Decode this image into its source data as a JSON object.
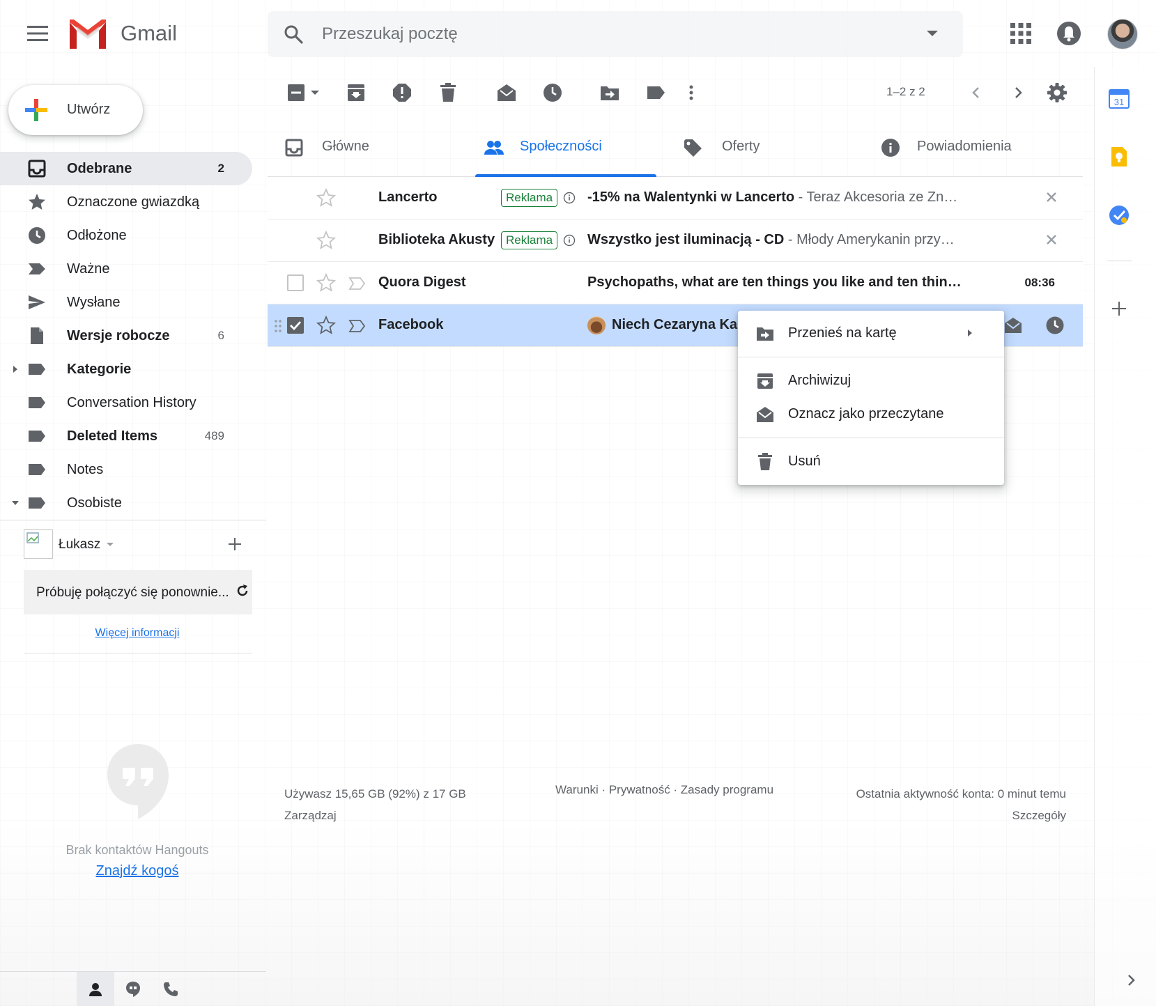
{
  "header": {
    "app_name": "Gmail",
    "search_placeholder": "Przeszukaj pocztę"
  },
  "compose": {
    "label": "Utwórz"
  },
  "nav": {
    "items": [
      {
        "label": "Odebrane",
        "count": "2",
        "icon": "inbox-icon",
        "bold": true,
        "active": true
      },
      {
        "label": "Oznaczone gwiazdką",
        "count": "",
        "icon": "star-icon"
      },
      {
        "label": "Odłożone",
        "count": "",
        "icon": "clock-icon"
      },
      {
        "label": "Ważne",
        "count": "",
        "icon": "important-icon"
      },
      {
        "label": "Wysłane",
        "count": "",
        "icon": "send-icon"
      },
      {
        "label": "Wersje robocze",
        "count": "6",
        "icon": "draft-icon",
        "bold": true
      },
      {
        "label": "Kategorie",
        "count": "",
        "icon": "label-icon",
        "bold": true
      },
      {
        "label": "Conversation History",
        "count": "",
        "icon": "label-icon"
      },
      {
        "label": "Deleted Items",
        "count": "489",
        "icon": "label-icon",
        "bold": true
      },
      {
        "label": "Notes",
        "count": "",
        "icon": "label-icon"
      },
      {
        "label": "Osobiste",
        "count": "",
        "icon": "label-icon"
      }
    ]
  },
  "hangouts": {
    "user_name": "Łukasz",
    "reconnect_text": "Próbuję połączyć się ponownie...",
    "more_info": "Więcej informacji",
    "no_contacts": "Brak kontaktów Hangouts",
    "find_someone": "Znajdź kogoś"
  },
  "toolbar": {
    "pagination": "1–2 z 2"
  },
  "tabs": [
    {
      "label": "Główne",
      "icon": "inbox-icon"
    },
    {
      "label": "Społeczności",
      "icon": "people-icon",
      "active": true
    },
    {
      "label": "Oferty",
      "icon": "tag-icon"
    },
    {
      "label": "Powiadomienia",
      "icon": "info-icon"
    }
  ],
  "emails": [
    {
      "sender": "Lancerto",
      "ad_label": "Reklama",
      "subject": "-15% na Walentynki w Lancerto",
      "snippet": " - Teraz Akcesoria ze Zn…"
    },
    {
      "sender": "Biblioteka Akusty",
      "ad_label": "Reklama",
      "subject": "Wszystko jest iluminacją - CD",
      "snippet": " - Młody Amerykanin przy…"
    },
    {
      "sender": "Quora Digest",
      "subject": "Psychopaths, what are ten things you like and ten thin…",
      "time": "08:36"
    },
    {
      "sender": "Facebook",
      "subject": "Niech Cezaryna Ka"
    }
  ],
  "context_menu": {
    "items": [
      {
        "label": "Przenieś na kartę",
        "icon": "move-to-tab-icon"
      },
      {
        "label": "Archiwizuj",
        "icon": "archive-icon"
      },
      {
        "label": "Oznacz jako przeczytane",
        "icon": "mark-read-icon"
      },
      {
        "label": "Usuń",
        "icon": "trash-icon"
      }
    ]
  },
  "footer": {
    "storage": "Używasz 15,65 GB (92%) z 17 GB",
    "manage": "Zarządzaj",
    "terms": "Warunki · Prywatność · Zasady programu",
    "last_activity": "Ostatnia aktywność konta: 0 minut temu",
    "details": "Szczegóły"
  },
  "side_panel": {
    "calendar_day": "31"
  },
  "colors": {
    "accent": "#1a73e8",
    "selected_row": "#c2dbff",
    "ad_green": "#188038"
  }
}
